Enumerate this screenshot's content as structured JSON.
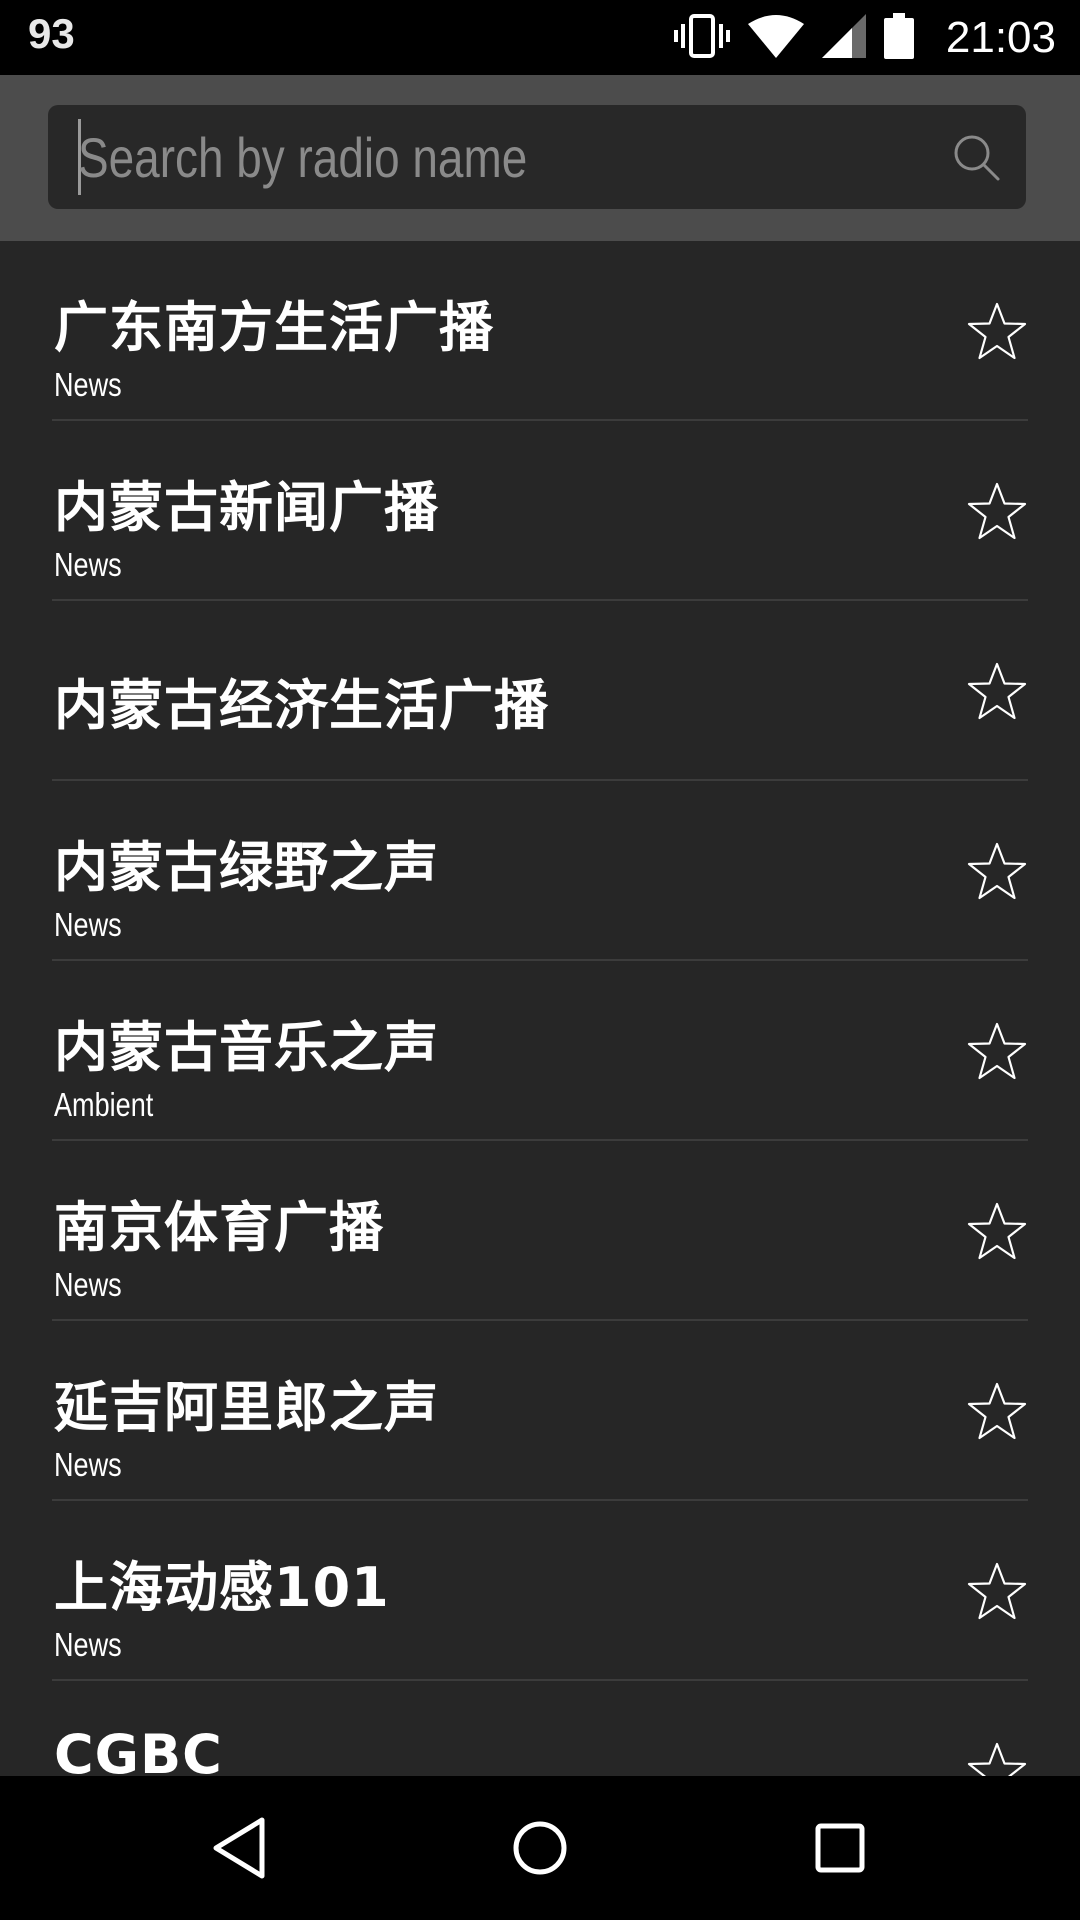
{
  "status_bar": {
    "battery_level": "93",
    "time": "21:03",
    "icons": [
      "vibrate-icon",
      "wifi-icon",
      "cell-signal-icon",
      "battery-icon"
    ]
  },
  "search": {
    "placeholder": "Search by radio name",
    "value": "",
    "icon": "search-icon"
  },
  "stations": [
    {
      "name": "广东南方生活广播",
      "genre": "News"
    },
    {
      "name": "内蒙古新闻广播",
      "genre": "News"
    },
    {
      "name": "内蒙古经济生活广播",
      "genre": ""
    },
    {
      "name": "内蒙古绿野之声",
      "genre": "News"
    },
    {
      "name": "内蒙古音乐之声",
      "genre": "Ambient"
    },
    {
      "name": "南京体育广播",
      "genre": "News"
    },
    {
      "name": "延吉阿里郎之声",
      "genre": "News"
    },
    {
      "name": "上海动感101",
      "genre": "News"
    },
    {
      "name": "CGBC",
      "genre": ""
    }
  ],
  "colors": {
    "header_bg": "#4c4c4c",
    "search_bg": "#282828",
    "list_bg": "#262626",
    "divider": "#3c3c3c",
    "text": "#ffffff"
  },
  "nav_bar": {
    "icons": [
      "back-icon",
      "home-icon",
      "recents-icon"
    ]
  }
}
